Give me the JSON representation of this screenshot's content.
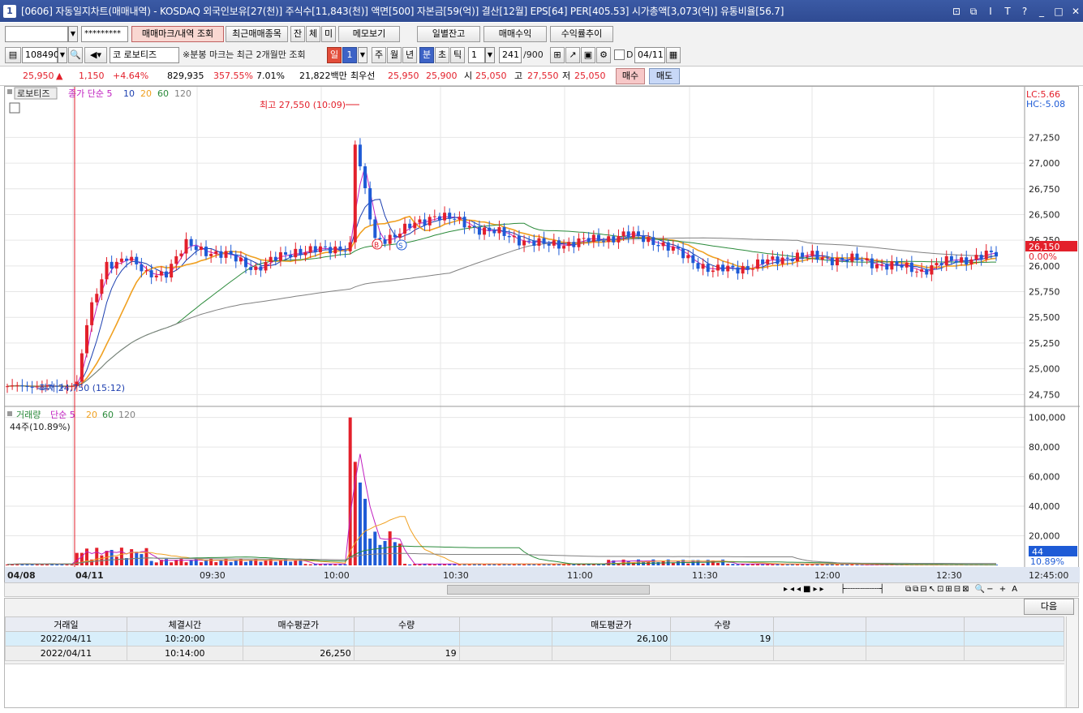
{
  "window": {
    "icon_label": "1",
    "title": "[0606] 자동일지차트(매매내역) - KOSDAQ 외국인보유[27(천)] 주식수[11,843(천)] 액면[500] 자본금[59(억)] 결산[12월] EPS[64] PER[405.53] 시가총액[3,073(억)] 유통비율[56.7]",
    "title_buttons": [
      "⊡",
      "⧉",
      "I",
      "T",
      "?",
      "_",
      "□",
      "✕"
    ]
  },
  "toolbar1": {
    "account_value": "",
    "password_mask": "*********",
    "buttons": [
      "매매마크/내역 조회",
      "최근매매종목",
      "잔",
      "체",
      "미",
      "메모보기",
      "일별잔고",
      "매매수익",
      "수익률추이"
    ]
  },
  "toolbar2": {
    "code": "108490",
    "market_badge": "코",
    "stock_name": "로보티즈",
    "note": "※분봉 마크는 최근 2개월만 조회",
    "period_buttons": [
      "일",
      "1",
      "주",
      "월",
      "년",
      "분",
      "초",
      "틱"
    ],
    "interval_value": "1",
    "count_text": "241",
    "count_max": "/900",
    "date_checkbox_label": "D",
    "date_value": "04/11"
  },
  "quote": {
    "price": "25,950",
    "arrow": "▲",
    "change": "1,150",
    "change_pct": "+4.64%",
    "volume": "829,935",
    "vol_ratio": "357.55%",
    "turnover": "7.01%",
    "amount": "21,822백만",
    "best_ask_label": "최우선",
    "best_ask": "25,950",
    "best_bid": "25,900",
    "open_label": "시",
    "open": "25,050",
    "high_label": "고",
    "high": "27,550",
    "low_label": "저",
    "low": "25,050",
    "buy_label": "매수",
    "sell_label": "매도"
  },
  "chart_data": {
    "type": "candlestick+volume",
    "price_panel": {
      "legend_name": "로보티즈",
      "legend_series": [
        "종가 단순 5",
        "10",
        "20",
        "60",
        "120"
      ],
      "yticks": [
        "27,250",
        "27,000",
        "26,750",
        "26,500",
        "26,250",
        "26,000",
        "25,750",
        "25,500",
        "25,250",
        "25,000",
        "24,750"
      ],
      "ylim": [
        24650,
        27600
      ],
      "max_annotation": "최고 27,550 (10:09)",
      "min_annotation": "최저 24,750 (15:12)",
      "lc_label": "LC:5.66",
      "hc_label": "HC:-5.08",
      "last_price_tag": "26,150",
      "pct_tag": "0.00%",
      "trade_marks": [
        "B",
        "S"
      ]
    },
    "volume_panel": {
      "legend_name": "거래량",
      "legend_series": [
        "단순 5",
        "20",
        "60",
        "120"
      ],
      "current_label": "44주(10.89%)",
      "yticks": [
        "100,000",
        "80,000",
        "60,000",
        "40,000",
        "20,000"
      ],
      "ylim": [
        0,
        102000
      ],
      "last_volume_tag": "44",
      "pct_tag": "10.89%"
    },
    "xticks": [
      "04/08",
      "04/11",
      "09:30",
      "10:00",
      "10:30",
      "11:00",
      "11:30",
      "12:00",
      "12:30",
      "12:45:00"
    ],
    "series_colors": {
      "ma5": "#c020c0",
      "ma10": "#1c3fb0",
      "ma20": "#f0a020",
      "ma60": "#2a8a3a",
      "ma120": "#808080",
      "up": "#e3202b",
      "down": "#1e5bd6"
    }
  },
  "bottom": {
    "next_button": "다음",
    "columns": [
      "거래일",
      "체결시간",
      "매수평균가",
      "수량",
      "",
      "매도평균가",
      "수량",
      "",
      "",
      ""
    ],
    "rows": [
      [
        "2022/04/11",
        "10:20:00",
        "",
        "",
        "",
        "26,100",
        "19",
        "",
        "",
        ""
      ],
      [
        "2022/04/11",
        "10:14:00",
        "26,250",
        "19",
        "",
        "",
        "",
        "",
        "",
        ""
      ]
    ]
  }
}
